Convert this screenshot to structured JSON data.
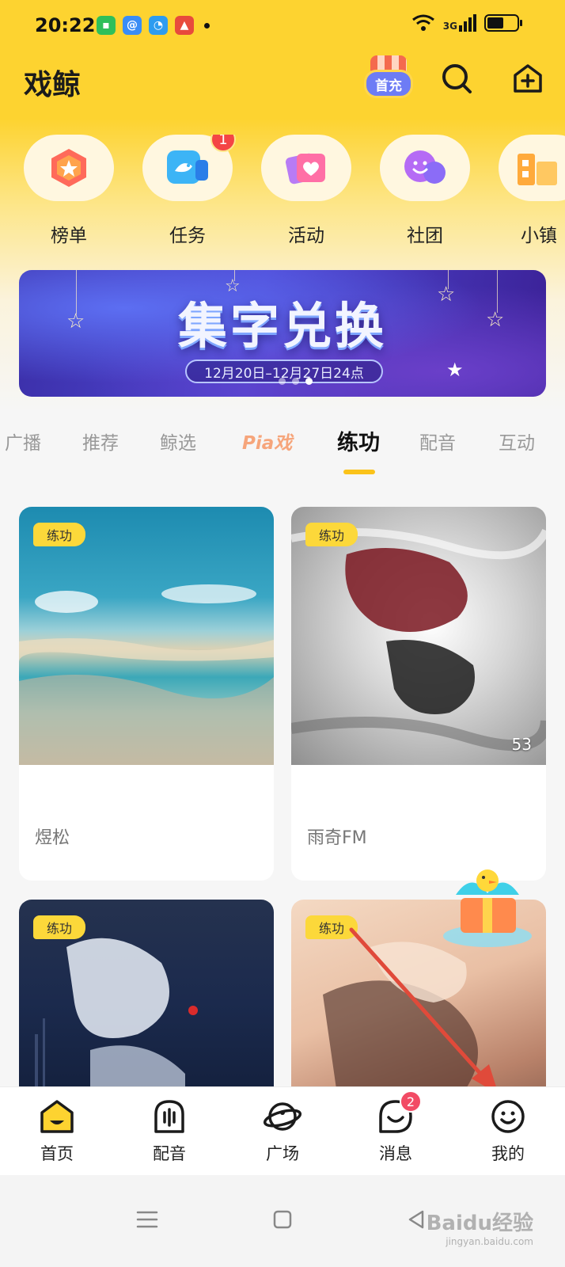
{
  "status_bar": {
    "time": "20:22",
    "network_label": "3G",
    "notification_icons": [
      "message-icon",
      "qq-icon",
      "qq-browser-icon",
      "app-icon"
    ]
  },
  "header": {
    "title": "戏鲸",
    "badge_text": "首充"
  },
  "quick_entries": [
    {
      "label": "榜单",
      "icon": "ranking-icon",
      "badge": ""
    },
    {
      "label": "任务",
      "icon": "task-icon",
      "badge": "1"
    },
    {
      "label": "活动",
      "icon": "activity-icon",
      "badge": ""
    },
    {
      "label": "社团",
      "icon": "club-icon",
      "badge": ""
    },
    {
      "label": "小镇",
      "icon": "town-icon",
      "badge": ""
    }
  ],
  "banner": {
    "title": "集字兑换",
    "date_range": "12月20日–12月27日24点"
  },
  "tabs": [
    {
      "label": "广播",
      "active": false
    },
    {
      "label": "推荐",
      "active": false
    },
    {
      "label": "鲸选",
      "active": false
    },
    {
      "label": "Pia戏",
      "active": false
    },
    {
      "label": "练功",
      "active": true
    },
    {
      "label": "配音",
      "active": false
    },
    {
      "label": "互动",
      "active": false
    }
  ],
  "cards": [
    {
      "tag": "练功",
      "title": "",
      "author": "煜松",
      "count": ""
    },
    {
      "tag": "练功",
      "title": "",
      "author": "雨奇FM",
      "count": "53"
    },
    {
      "tag": "练功",
      "title": "",
      "author": "",
      "count": ""
    },
    {
      "tag": "练功",
      "title": "",
      "author": "",
      "count": ""
    }
  ],
  "bottom_nav": [
    {
      "label": "首页",
      "icon": "home-icon",
      "badge": ""
    },
    {
      "label": "配音",
      "icon": "dubbing-icon",
      "badge": ""
    },
    {
      "label": "广场",
      "icon": "plaza-icon",
      "badge": ""
    },
    {
      "label": "消息",
      "icon": "message-icon",
      "badge": "2"
    },
    {
      "label": "我的",
      "icon": "profile-icon",
      "badge": ""
    }
  ],
  "colors": {
    "brand_yellow": "#fdd330",
    "tab_indicator": "#fbc31a",
    "badge_red": "#f44545",
    "annotation_arrow": "#e04a3a"
  },
  "watermark": {
    "brand": "Baidu经验",
    "url": "jingyan.baidu.com"
  }
}
